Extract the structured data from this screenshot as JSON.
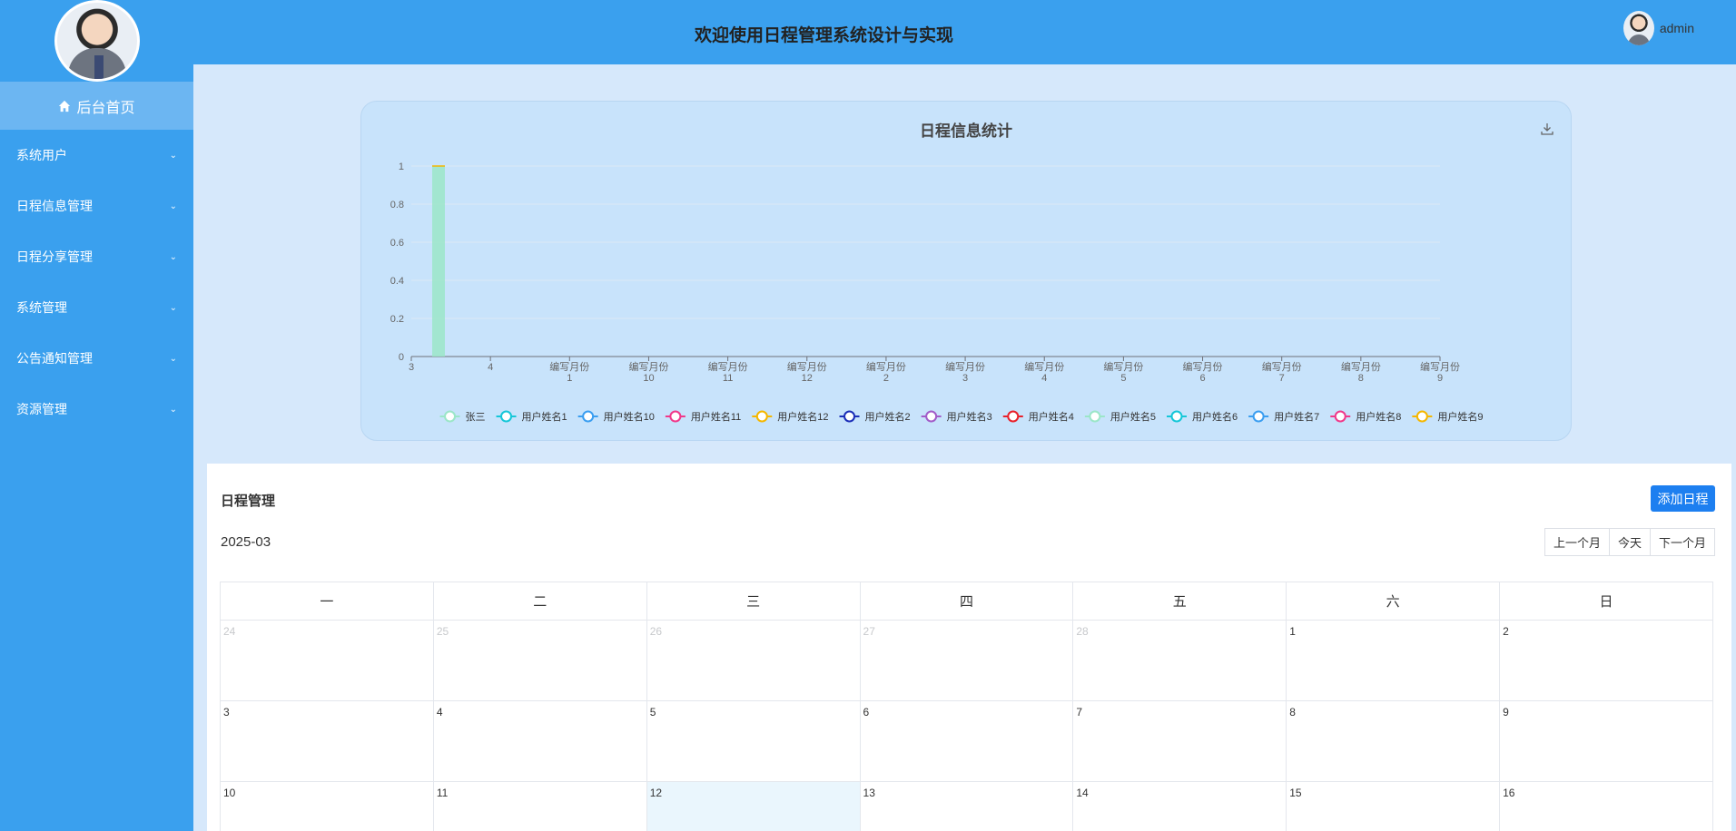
{
  "header": {
    "title": "欢迎使用日程管理系统设计与实现",
    "username": "admin"
  },
  "sidebar": {
    "home": "后台首页",
    "items": [
      {
        "label": "系统用户"
      },
      {
        "label": "日程信息管理"
      },
      {
        "label": "日程分享管理"
      },
      {
        "label": "系统管理"
      },
      {
        "label": "公告通知管理"
      },
      {
        "label": "资源管理"
      }
    ]
  },
  "chart_data": {
    "type": "bar",
    "title": "日程信息统计",
    "categories": [
      "3",
      "4",
      "编写月份\n1",
      "编写月份\n10",
      "编写月份\n11",
      "编写月份\n12",
      "编写月份\n2",
      "编写月份\n3",
      "编写月份\n4",
      "编写月份\n5",
      "编写月份\n6",
      "编写月份\n7",
      "编写月份\n8",
      "编写月份\n9"
    ],
    "series": [
      {
        "name": "张三",
        "values": [
          1,
          0,
          0,
          0,
          0,
          0,
          0,
          0,
          0,
          0,
          0,
          0,
          0,
          0
        ],
        "color": "#9be6c8"
      },
      {
        "name": "用户姓名1",
        "values": [
          0,
          0,
          0,
          0,
          0,
          0,
          0,
          0,
          0,
          0,
          0,
          0,
          0,
          0
        ],
        "color": "#16c7d8"
      },
      {
        "name": "用户姓名10",
        "values": [
          0,
          0,
          0,
          0,
          0,
          0,
          0,
          0,
          0,
          0,
          0,
          0,
          0,
          0
        ],
        "color": "#3b9ef0"
      },
      {
        "name": "用户姓名11",
        "values": [
          0,
          0,
          0,
          0,
          0,
          0,
          0,
          0,
          0,
          0,
          0,
          0,
          0,
          0
        ],
        "color": "#f0398a"
      },
      {
        "name": "用户姓名12",
        "values": [
          0,
          0,
          0,
          0,
          0,
          0,
          0,
          0,
          0,
          0,
          0,
          0,
          0,
          0
        ],
        "color": "#f5b700"
      },
      {
        "name": "用户姓名2",
        "values": [
          0,
          0,
          0,
          0,
          0,
          0,
          0,
          0,
          0,
          0,
          0,
          0,
          0,
          0
        ],
        "color": "#1c2fb8"
      },
      {
        "name": "用户姓名3",
        "values": [
          0,
          0,
          0,
          0,
          0,
          0,
          0,
          0,
          0,
          0,
          0,
          0,
          0,
          0
        ],
        "color": "#a25cc8"
      },
      {
        "name": "用户姓名4",
        "values": [
          0,
          0,
          0,
          0,
          0,
          0,
          0,
          0,
          0,
          0,
          0,
          0,
          0,
          0
        ],
        "color": "#e8212b"
      },
      {
        "name": "用户姓名5",
        "values": [
          0,
          0,
          0,
          0,
          0,
          0,
          0,
          0,
          0,
          0,
          0,
          0,
          0,
          0
        ],
        "color": "#9be6c8"
      },
      {
        "name": "用户姓名6",
        "values": [
          0,
          0,
          0,
          0,
          0,
          0,
          0,
          0,
          0,
          0,
          0,
          0,
          0,
          0
        ],
        "color": "#16c7d8"
      },
      {
        "name": "用户姓名7",
        "values": [
          0,
          0,
          0,
          0,
          0,
          0,
          0,
          0,
          0,
          0,
          0,
          0,
          0,
          0
        ],
        "color": "#3b9ef0"
      },
      {
        "name": "用户姓名8",
        "values": [
          0,
          0,
          0,
          0,
          0,
          0,
          0,
          0,
          0,
          0,
          0,
          0,
          0,
          0
        ],
        "color": "#f0398a"
      },
      {
        "name": "用户姓名9",
        "values": [
          0,
          0,
          0,
          0,
          0,
          0,
          0,
          0,
          0,
          0,
          0,
          0,
          0,
          0
        ],
        "color": "#f5b700"
      }
    ],
    "yticks": [
      "0",
      "0.2",
      "0.4",
      "0.6",
      "0.8",
      "1"
    ],
    "ylim": [
      0,
      1
    ],
    "legend_position": "bottom"
  },
  "schedule": {
    "title": "日程管理",
    "add_button": "添加日程",
    "month": "2025-03",
    "prev_button": "上一个月",
    "today_button": "今天",
    "next_button": "下一个月",
    "weekdays": [
      "一",
      "二",
      "三",
      "四",
      "五",
      "六",
      "日"
    ],
    "weeks": [
      [
        {
          "d": "24",
          "muted": true
        },
        {
          "d": "25",
          "muted": true
        },
        {
          "d": "26",
          "muted": true
        },
        {
          "d": "27",
          "muted": true
        },
        {
          "d": "28",
          "muted": true
        },
        {
          "d": "1"
        },
        {
          "d": "2"
        }
      ],
      [
        {
          "d": "3"
        },
        {
          "d": "4"
        },
        {
          "d": "5"
        },
        {
          "d": "6"
        },
        {
          "d": "7"
        },
        {
          "d": "8"
        },
        {
          "d": "9"
        }
      ],
      [
        {
          "d": "10"
        },
        {
          "d": "11"
        },
        {
          "d": "12",
          "today": true
        },
        {
          "d": "13"
        },
        {
          "d": "14"
        },
        {
          "d": "15"
        },
        {
          "d": "16"
        }
      ]
    ]
  }
}
